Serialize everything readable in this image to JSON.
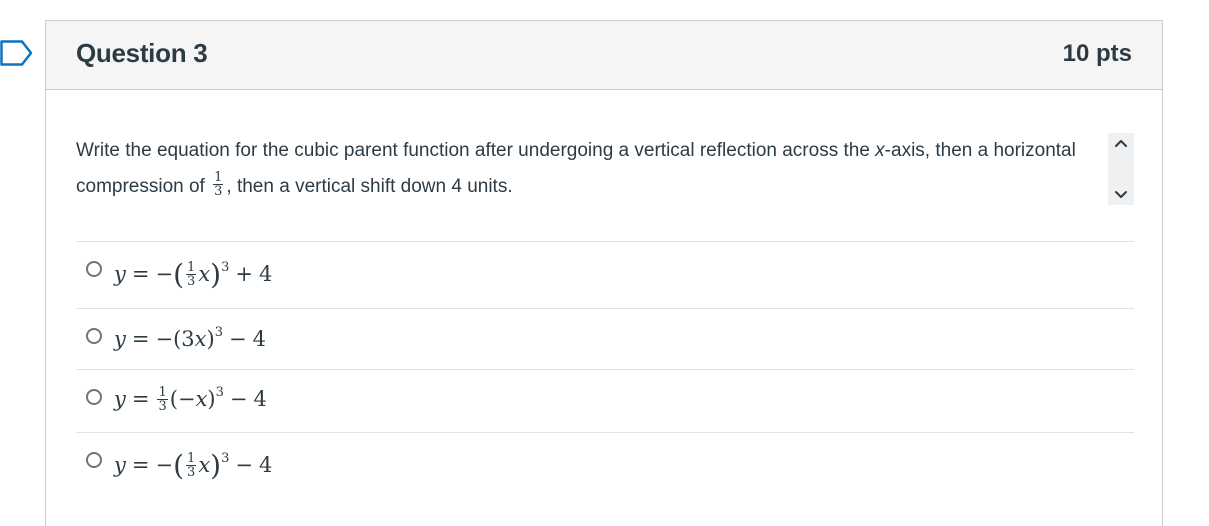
{
  "question": {
    "title": "Question 3",
    "points": "10 pts",
    "prompt_part1": "Write the equation for the cubic parent function after undergoing a vertical reflection across the ",
    "prompt_var": "x",
    "prompt_part2": "-axis, then a horizontal compression of ",
    "prompt_frac_num": "1",
    "prompt_frac_den": "3",
    "prompt_part3": ", then a vertical shift down 4 units."
  },
  "answers": [
    {
      "id": "a1",
      "selected": false,
      "y": "y",
      "eq": "=",
      "neg": "−",
      "lparen": "(",
      "frac_num": "1",
      "frac_den": "3",
      "x": "x",
      "rparen": ")",
      "exp": "3",
      "op": "+",
      "const": "4"
    },
    {
      "id": "a2",
      "selected": false,
      "y": "y",
      "eq": "=",
      "pre": "−(3",
      "x": "x",
      "post": ")",
      "exp": "3",
      "op": "−",
      "const": "4"
    },
    {
      "id": "a3",
      "selected": false,
      "y": "y",
      "eq": "=",
      "frac_num": "1",
      "frac_den": "3",
      "pre": "(−",
      "x": "x",
      "post": ")",
      "exp": "3",
      "op": "−",
      "const": "4"
    },
    {
      "id": "a4",
      "selected": false,
      "y": "y",
      "eq": "=",
      "neg": "−",
      "lparen": "(",
      "frac_num": "1",
      "frac_den": "3",
      "x": "x",
      "rparen": ")",
      "exp": "3",
      "op": "−",
      "const": "4"
    }
  ],
  "icons": {
    "flag": "bookmark-flag-icon",
    "scroll_up": "chevron-up-icon",
    "scroll_down": "chevron-down-icon",
    "radio": "radio-button-icon"
  },
  "colors": {
    "text": "#2d3b45",
    "header_bg": "#f5f5f5",
    "border": "#c7cdd1",
    "divider": "#dfe3e6"
  }
}
